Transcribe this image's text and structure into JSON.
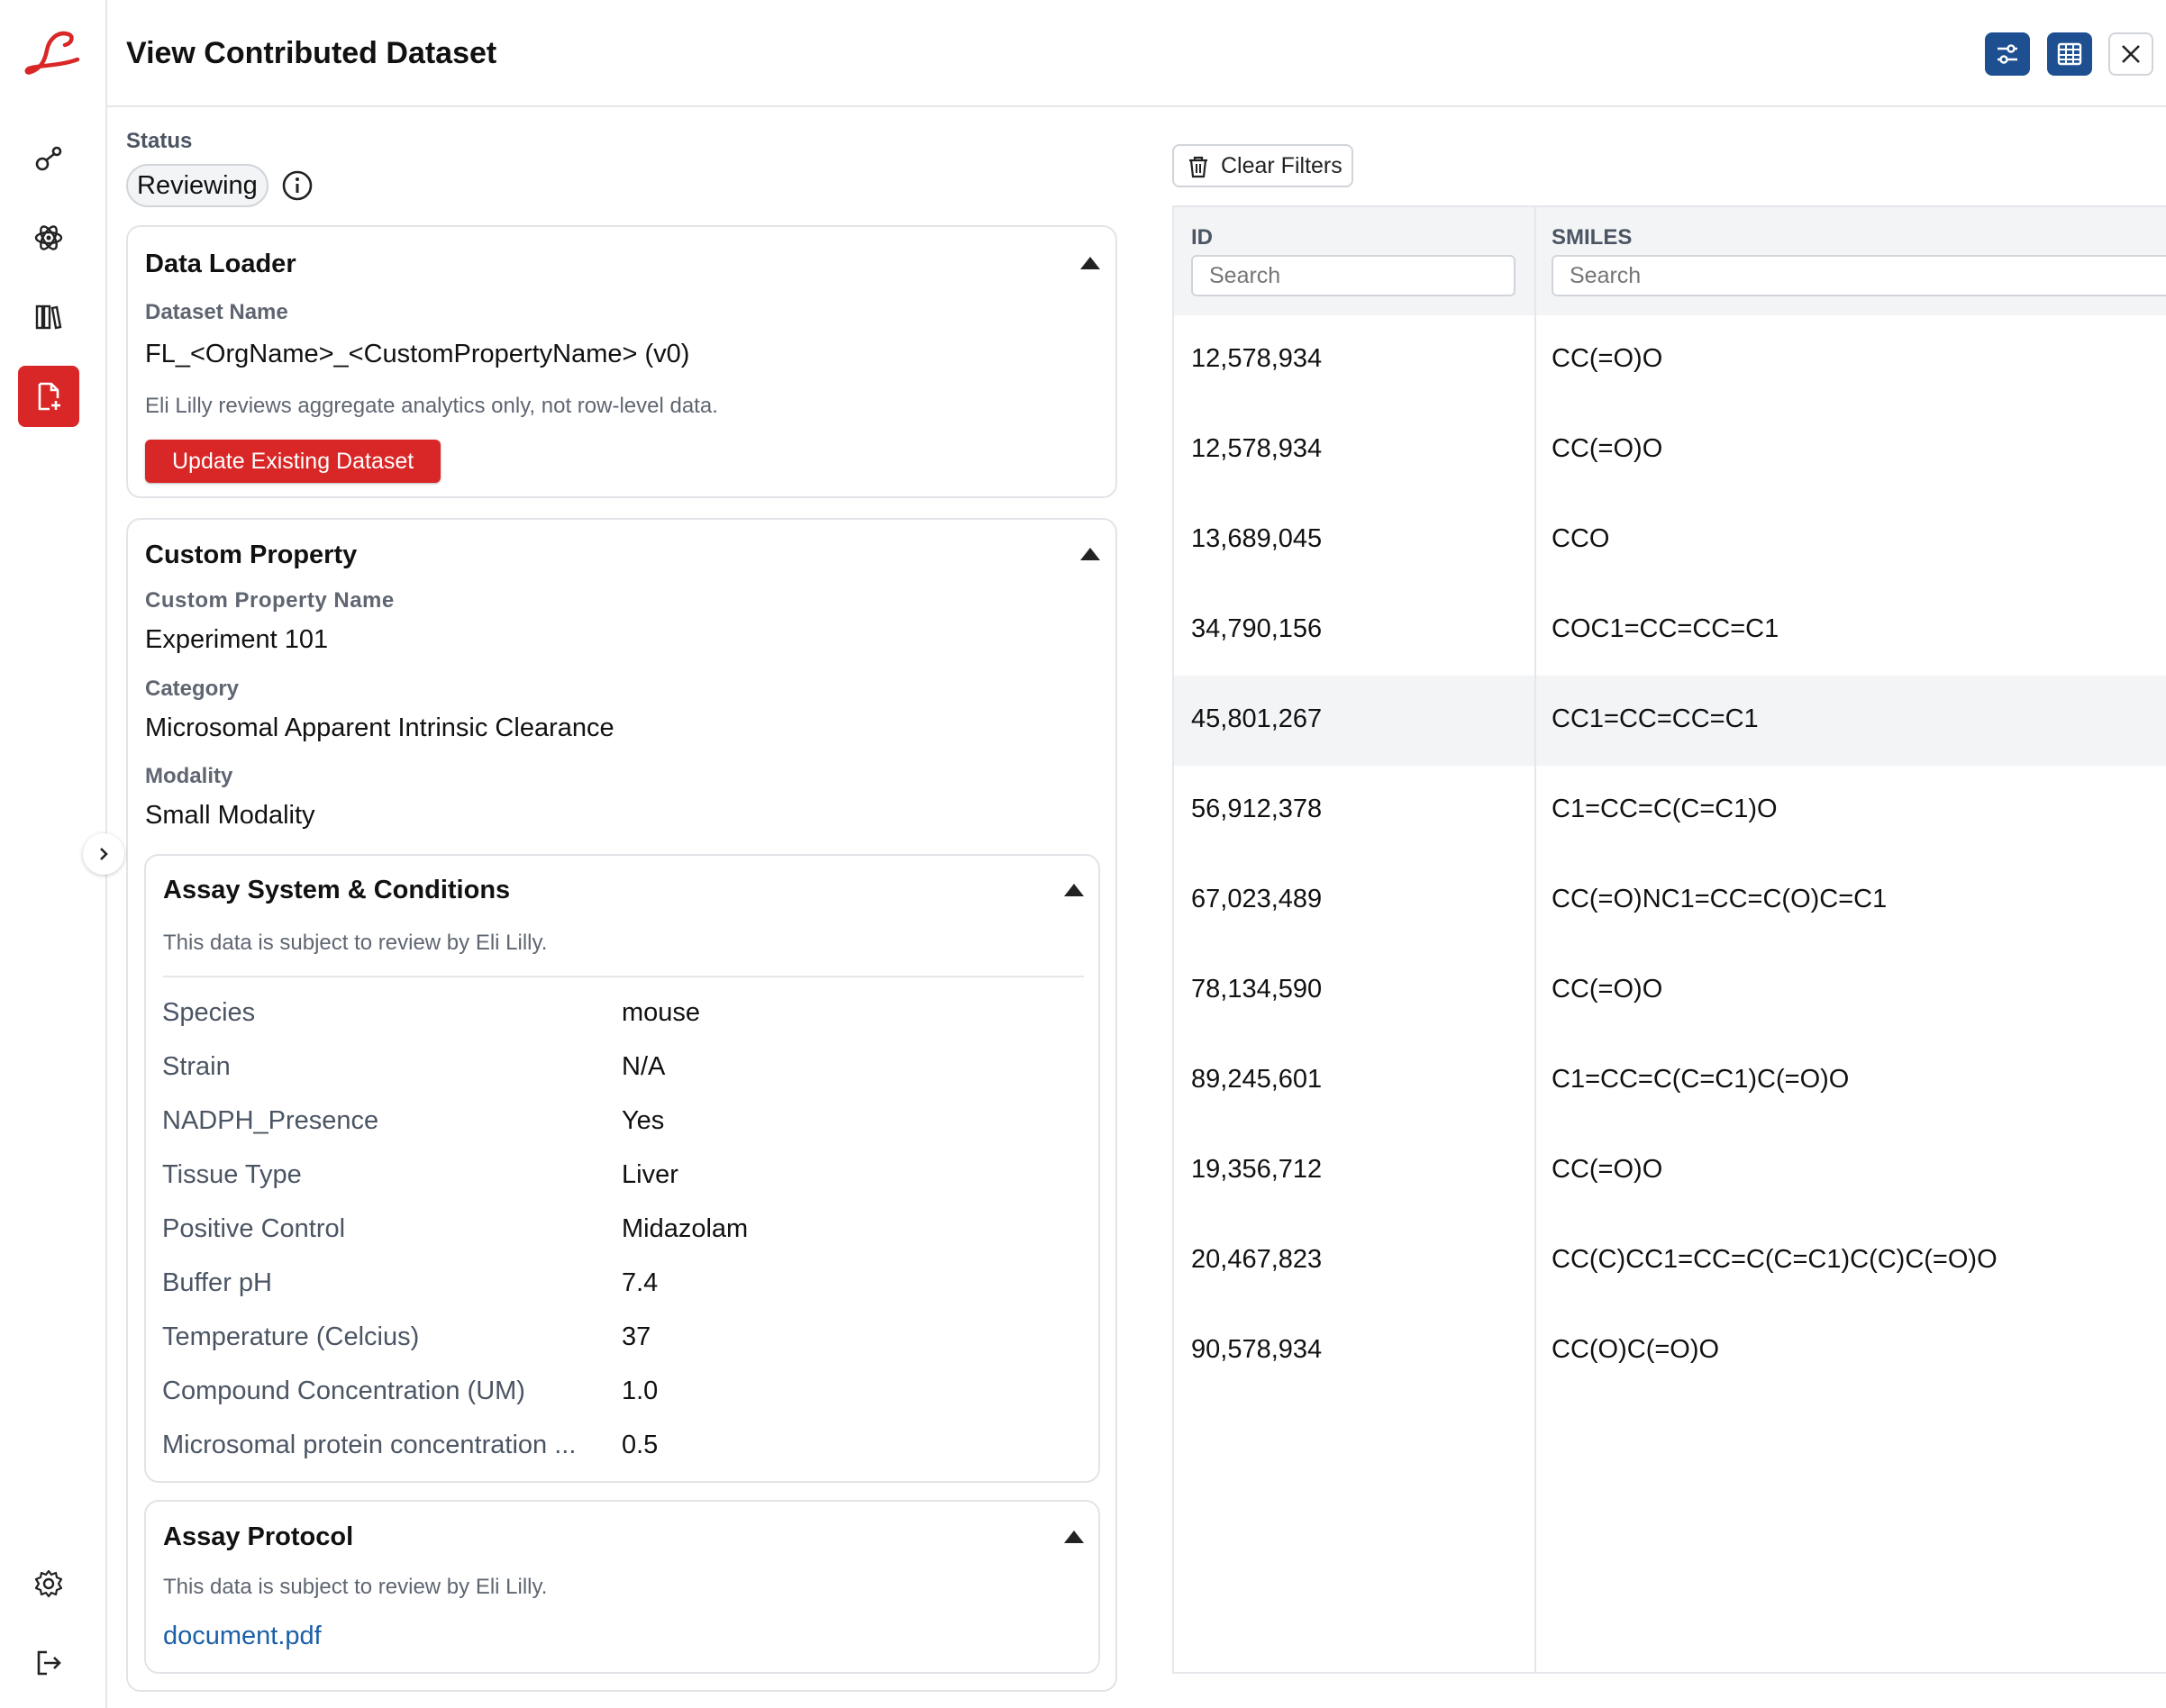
{
  "header": {
    "title": "View Contributed Dataset"
  },
  "status": {
    "label": "Status",
    "value": "Reviewing"
  },
  "data_loader": {
    "title": "Data Loader",
    "dataset_name_label": "Dataset Name",
    "dataset_name": "FL_<OrgName>_<CustomPropertyName> (v0)",
    "note": "Eli Lilly reviews aggregate analytics only, not row-level data.",
    "update_button": "Update Existing Dataset"
  },
  "custom_property": {
    "title": "Custom Property",
    "name_label": "Custom Property Name",
    "name_value": "Experiment 101",
    "category_label": "Category",
    "category_value": "Microsomal Apparent Intrinsic Clearance",
    "modality_label": "Modality",
    "modality_value": "Small Modality"
  },
  "assay_system": {
    "title": "Assay System & Conditions",
    "note": "This data is subject to review by Eli Lilly.",
    "rows": [
      {
        "key": "Species",
        "value": "mouse"
      },
      {
        "key": "Strain",
        "value": "N/A"
      },
      {
        "key": "NADPH_Presence",
        "value": "Yes"
      },
      {
        "key": "Tissue Type",
        "value": "Liver"
      },
      {
        "key": "Positive Control",
        "value": "Midazolam"
      },
      {
        "key": "Buffer pH",
        "value": "7.4"
      },
      {
        "key": "Temperature (Celcius)",
        "value": "37"
      },
      {
        "key": "Compound Concentration (UM)",
        "value": "1.0"
      },
      {
        "key": "Microsomal protein concentration ...",
        "value": "0.5"
      }
    ]
  },
  "assay_protocol": {
    "title": "Assay Protocol",
    "note": "This data is subject to review by Eli Lilly.",
    "file": "document.pdf"
  },
  "table": {
    "clear_filters": "Clear Filters",
    "columns": [
      {
        "label": "ID",
        "search_placeholder": "Search"
      },
      {
        "label": "SMILES",
        "search_placeholder": "Search"
      }
    ],
    "rows": [
      {
        "id": "12,578,934",
        "smiles": "CC(=O)O"
      },
      {
        "id": "12,578,934",
        "smiles": "CC(=O)O"
      },
      {
        "id": "13,689,045",
        "smiles": "CCO"
      },
      {
        "id": "34,790,156",
        "smiles": "COC1=CC=CC=C1"
      },
      {
        "id": "45,801,267",
        "smiles": "CC1=CC=CC=C1"
      },
      {
        "id": "56,912,378",
        "smiles": "C1=CC=C(C=C1)O"
      },
      {
        "id": "67,023,489",
        "smiles": "CC(=O)NC1=CC=C(O)C=C1"
      },
      {
        "id": "78,134,590",
        "smiles": "CC(=O)O"
      },
      {
        "id": "89,245,601",
        "smiles": "C1=CC=C(C=C1)C(=O)O"
      },
      {
        "id": "19,356,712",
        "smiles": "CC(=O)O"
      },
      {
        "id": "20,467,823",
        "smiles": "CC(C)CC1=CC=C(C=C1)C(C)C(=O)O"
      },
      {
        "id": "90,578,934",
        "smiles": "CC(O)C(=O)O"
      }
    ],
    "highlighted_row": 4
  },
  "colors": {
    "brand_red": "#d92626",
    "accent_blue": "#1d4f91",
    "link": "#1a5fa8"
  }
}
